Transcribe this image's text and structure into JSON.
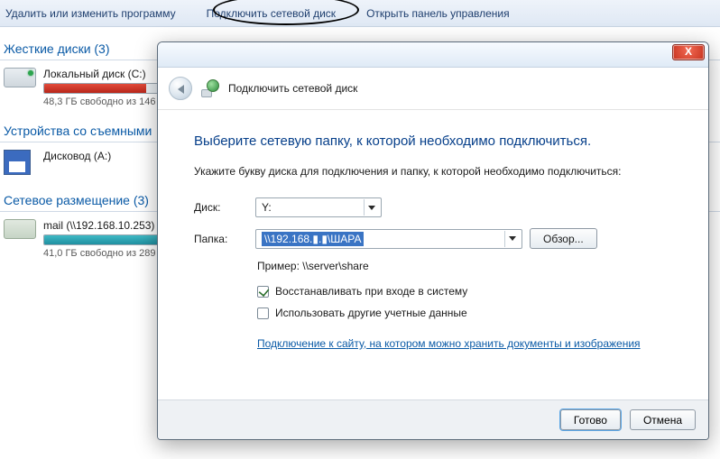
{
  "toolbar": {
    "uninstall": "Удалить или изменить программу",
    "map_drive": "Подключить сетевой диск",
    "control_panel": "Открыть панель управления"
  },
  "sections": {
    "hdd_title": "Жесткие диски (3)",
    "removable_title": "Устройства со съемными",
    "network_title": "Сетевое размещение (3)"
  },
  "drives": {
    "local_c": {
      "name": "Локальный диск (C:)",
      "info": "48,3 ГБ свободно из 146",
      "fill_pct": 67,
      "color": "red"
    },
    "floppy": {
      "name": "Дисковод (A:)"
    },
    "mail": {
      "name": "mail (\\\\192.168.10.253) (",
      "info": "41,0 ГБ свободно из 289",
      "fill_pct": 86,
      "color": "teal"
    }
  },
  "dialog": {
    "close_x": "X",
    "head_title": "Подключить сетевой диск",
    "h1": "Выберите сетевую папку, к которой необходимо подключиться.",
    "sub": "Укажите букву диска для подключения и папку, к которой необходимо подключиться:",
    "drive_label": "Диск:",
    "drive_value": "Y:",
    "folder_label": "Папка:",
    "folder_value": "\\\\192.168.▮.▮\\ШАРА",
    "browse": "Обзор...",
    "example": "Пример: \\\\server\\share",
    "chk_reconnect": "Восстанавливать при входе в систему",
    "chk_othercreds": "Использовать другие учетные данные",
    "link": "Подключение к сайту, на котором можно хранить документы и изображения",
    "btn_done": "Готово",
    "btn_cancel": "Отмена"
  }
}
